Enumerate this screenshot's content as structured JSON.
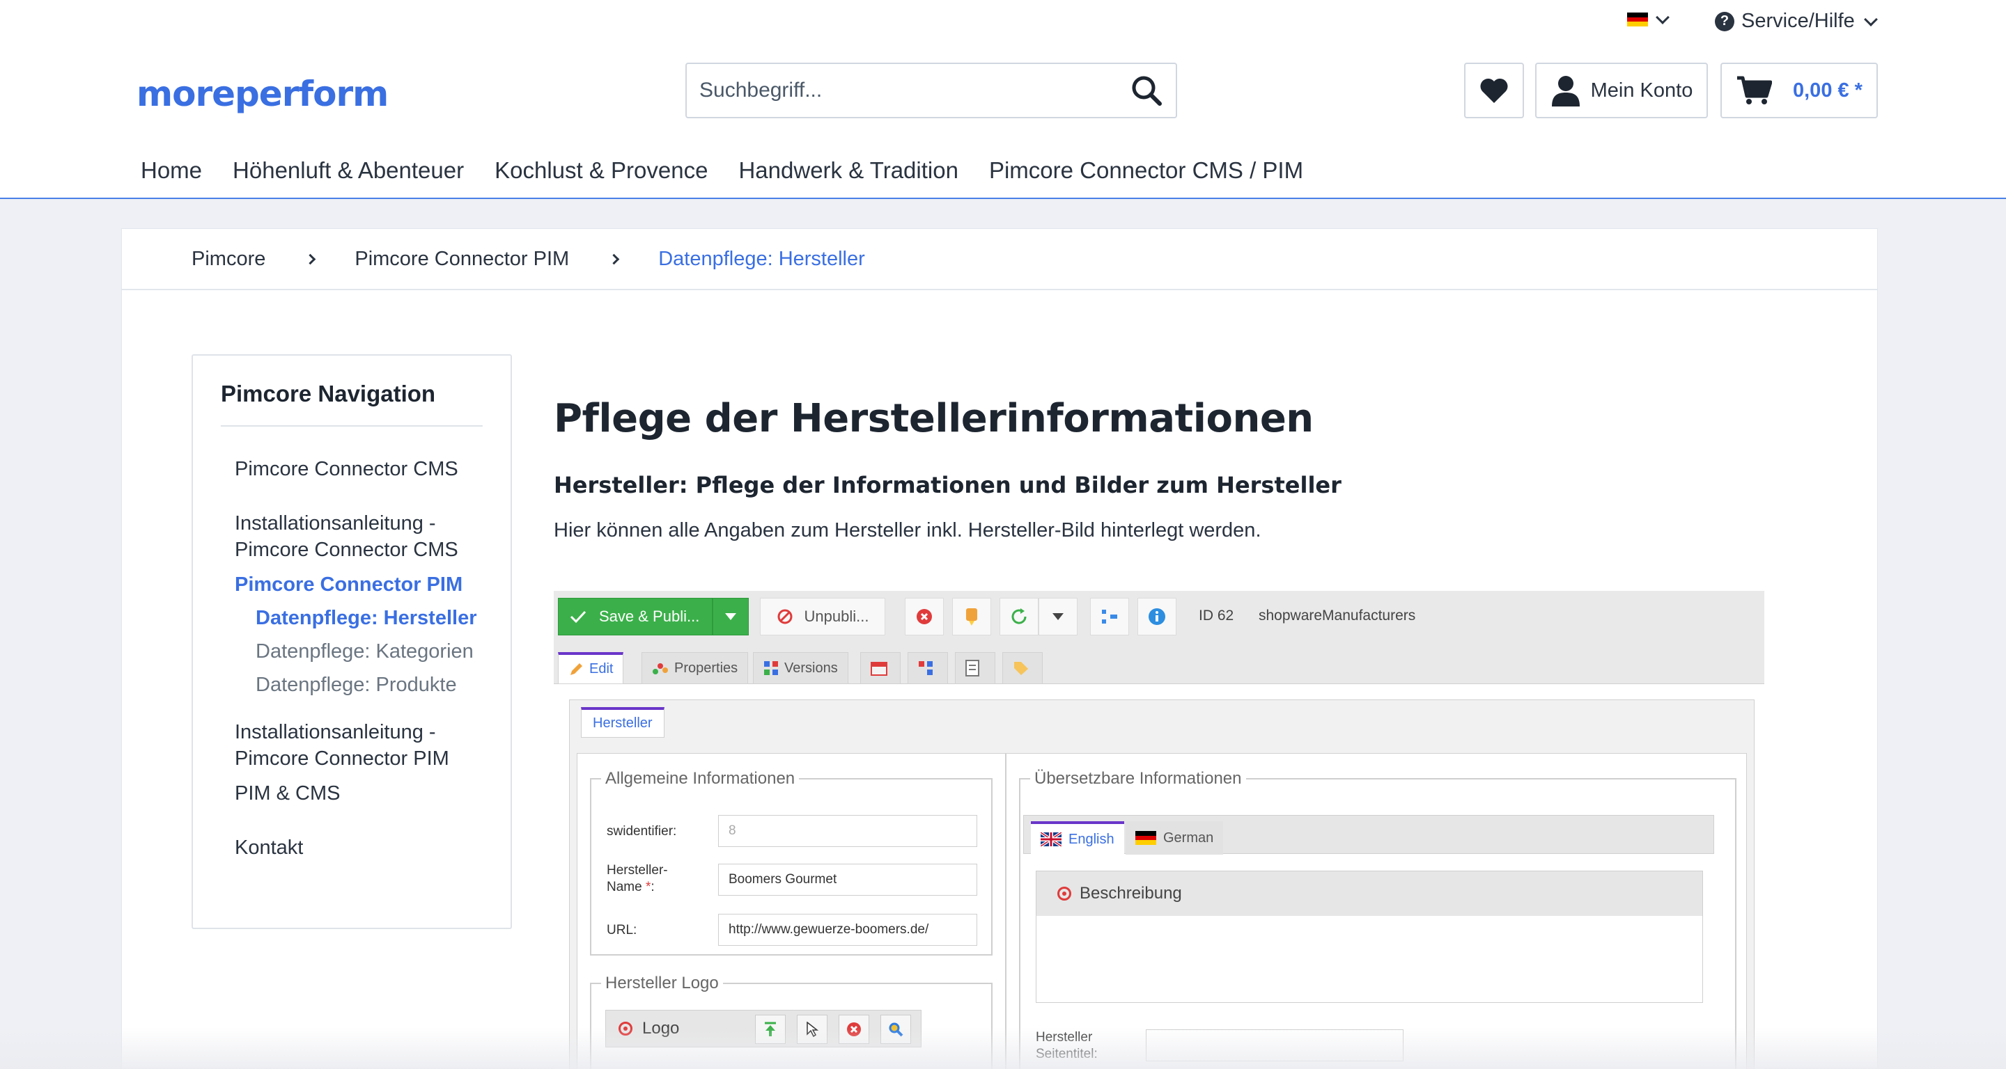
{
  "header": {
    "logo": "moreperform",
    "service_label": "Service/Hilfe",
    "search_placeholder": "Suchbegriff...",
    "account_label": "Mein Konto",
    "cart_total": "0,00 € *",
    "nav": [
      "Home",
      "Höhenluft & Abenteuer",
      "Kochlust & Provence",
      "Handwerk & Tradition",
      "Pimcore Connector CMS / PIM"
    ]
  },
  "breadcrumb": [
    "Pimcore",
    "Pimcore Connector PIM",
    "Datenpflege: Hersteller"
  ],
  "sidebar": {
    "title": "Pimcore Navigation",
    "items": [
      {
        "label": "Pimcore Connector CMS"
      },
      {
        "label": "Installationsanleitung - Pimcore Connector CMS"
      },
      {
        "label": "Pimcore Connector PIM"
      },
      {
        "label": "Installationsanleitung - Pimcore Connector PIM"
      },
      {
        "label": "PIM & CMS"
      },
      {
        "label": "Kontakt"
      }
    ],
    "subitems": [
      "Datenpflege: Hersteller",
      "Datenpflege: Kategorien",
      "Datenpflege: Produkte"
    ]
  },
  "article": {
    "title": "Pflege der Herstellerinformationen",
    "subtitle": "Hersteller: Pflege der Informationen und Bilder zum Hersteller",
    "text": "Hier können alle Angaben zum Hersteller inkl. Hersteller-Bild hinterlegt werden."
  },
  "screenshot": {
    "save_label": "Save & Publi...",
    "unpublish_label": "Unpubli...",
    "id_label": "ID 62",
    "class_label": "shopwareManufacturers",
    "tabs": [
      "Edit",
      "Properties",
      "Versions"
    ],
    "panel_tab": "Hersteller",
    "general_legend": "Allgemeine Informationen",
    "fields": [
      {
        "label": "swidentifier:",
        "value": "8"
      },
      {
        "label": "Hersteller-Name *:",
        "value": "Boomers Gourmet"
      },
      {
        "label": "URL:",
        "value": "http://www.gewuerze-boomers.de/"
      }
    ],
    "logo_legend": "Hersteller Logo",
    "logo_label": "Logo",
    "translatable_legend": "Übersetzbare Informationen",
    "lang_tabs": [
      "English",
      "German"
    ],
    "description_label": "Beschreibung",
    "page_title_label": "Hersteller Seitentitel:"
  }
}
